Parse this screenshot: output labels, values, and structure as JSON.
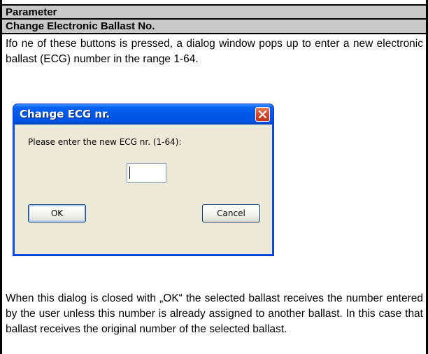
{
  "table": {
    "header": "Parameter",
    "title": "Change Electronic Ballast No.",
    "intro": "Ifo ne of these buttons is pressed, a dialog window pops up to enter a new electronic ballast (ECG) number in the range 1-64.",
    "outro": "When this dialog is closed with „OK“ the selected ballast receives the number entered by the user unless this number is already assigned to another ballast. In this case that ballast receives the original number of the selected ballast."
  },
  "dialog": {
    "title": "Change ECG nr.",
    "prompt": "Please enter the new ECG nr. (1-64):",
    "input_value": "",
    "ok_label": "OK",
    "cancel_label": "Cancel",
    "close_icon": "close-icon",
    "colors": {
      "titlebar": "#0054e3",
      "close_button": "#d6452b",
      "client_background": "#ece9d8"
    }
  },
  "colors": {
    "header_row": "#c8c8c8"
  }
}
